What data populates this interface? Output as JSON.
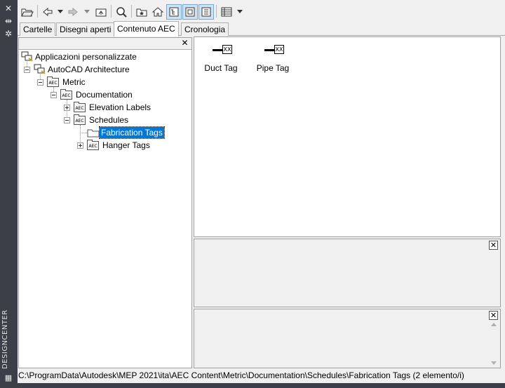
{
  "sidebar": {
    "title": "DESIGNCENTER",
    "icons": [
      "close-icon",
      "autohide-icon",
      "properties-icon",
      "grid-icon"
    ]
  },
  "toolbar": {
    "buttons": [
      "load-icon",
      "back-icon",
      "back-dropdown-icon",
      "forward-icon",
      "forward-dropdown-icon",
      "up-icon",
      "search-icon",
      "favorites-icon",
      "home-icon",
      "tree-view-toggle-icon",
      "preview-icon",
      "description-icon",
      "views-icon",
      "views-dropdown-icon"
    ]
  },
  "tabs": [
    {
      "label": "Cartelle",
      "active": false
    },
    {
      "label": "Disegni aperti",
      "active": false
    },
    {
      "label": "Contenuto AEC",
      "active": true
    },
    {
      "label": "Cronologia",
      "active": false
    }
  ],
  "tree": {
    "close_glyph": "✕",
    "nodes": [
      {
        "label": "Applicazioni personalizzate"
      },
      {
        "label": "AutoCAD Architecture"
      },
      {
        "label": "Metric"
      },
      {
        "label": "Documentation"
      },
      {
        "label": "Elevation Labels"
      },
      {
        "label": "Schedules"
      },
      {
        "label": "Fabrication Tags",
        "selected": true
      },
      {
        "label": "Hanger Tags"
      }
    ]
  },
  "content": {
    "items": [
      {
        "label": "Duct Tag",
        "glyph": "XX"
      },
      {
        "label": "Pipe Tag",
        "glyph": "XX"
      }
    ]
  },
  "preview": {
    "close_glyph": "✕"
  },
  "description": {
    "close_glyph": "✕"
  },
  "status": {
    "path": "C:\\ProgramData\\Autodesk\\MEP 2021\\ita\\AEC Content\\Metric\\Documentation\\Schedules\\Fabrication Tags (2 elemento/i)"
  },
  "colors": {
    "selection": "#0078d7",
    "sidebar": "#3b4048",
    "toggle_active": "#cfe3f7"
  }
}
